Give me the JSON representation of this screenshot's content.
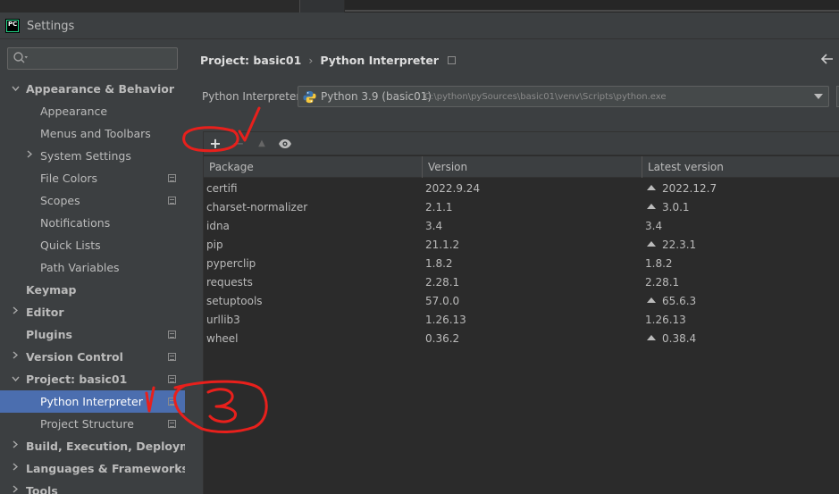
{
  "window": {
    "title": "Settings",
    "app_icon_text": "PC"
  },
  "sidebar": {
    "search_placeholder": "",
    "items": [
      {
        "label": "Appearance & Behavior",
        "expanded": true
      },
      {
        "label": "Appearance"
      },
      {
        "label": "Menus and Toolbars"
      },
      {
        "label": "System Settings"
      },
      {
        "label": "File Colors"
      },
      {
        "label": "Scopes"
      },
      {
        "label": "Notifications"
      },
      {
        "label": "Quick Lists"
      },
      {
        "label": "Path Variables"
      },
      {
        "label": "Keymap"
      },
      {
        "label": "Editor"
      },
      {
        "label": "Plugins"
      },
      {
        "label": "Version Control"
      },
      {
        "label": "Project: basic01",
        "expanded": true
      },
      {
        "label": "Python Interpreter",
        "selected": true
      },
      {
        "label": "Project Structure"
      },
      {
        "label": "Build, Execution, Deployment"
      },
      {
        "label": "Languages & Frameworks"
      },
      {
        "label": "Tools"
      }
    ]
  },
  "breadcrumb": {
    "project": "Project: basic01",
    "separator": "›",
    "page": "Python Interpreter"
  },
  "interpreter": {
    "label": "Python Interpreter:",
    "name": "Python 3.9 (basic01)",
    "path": "C:\\python\\pySources\\basic01\\venv\\Scripts\\python.exe"
  },
  "toolbar": {
    "add": "+",
    "remove": "−",
    "upgrade": "▲"
  },
  "table": {
    "headers": [
      "Package",
      "Version",
      "Latest version"
    ],
    "rows": [
      {
        "package": "certifi",
        "version": "2022.9.24",
        "latest": "2022.12.7",
        "upgradable": true
      },
      {
        "package": "charset-normalizer",
        "version": "2.1.1",
        "latest": "3.0.1",
        "upgradable": true
      },
      {
        "package": "idna",
        "version": "3.4",
        "latest": "3.4",
        "upgradable": false
      },
      {
        "package": "pip",
        "version": "21.1.2",
        "latest": "22.3.1",
        "upgradable": true
      },
      {
        "package": "pyperclip",
        "version": "1.8.2",
        "latest": "1.8.2",
        "upgradable": false
      },
      {
        "package": "requests",
        "version": "2.28.1",
        "latest": "2.28.1",
        "upgradable": false
      },
      {
        "package": "setuptools",
        "version": "57.0.0",
        "latest": "65.6.3",
        "upgradable": true
      },
      {
        "package": "urllib3",
        "version": "1.26.13",
        "latest": "1.26.13",
        "upgradable": false
      },
      {
        "package": "wheel",
        "version": "0.36.2",
        "latest": "0.38.4",
        "upgradable": true
      }
    ]
  },
  "colors": {
    "background": "#3c3f41",
    "selection": "#4b6eaf",
    "table_bg": "#2b2b2b",
    "annotation": "#e8201c"
  }
}
